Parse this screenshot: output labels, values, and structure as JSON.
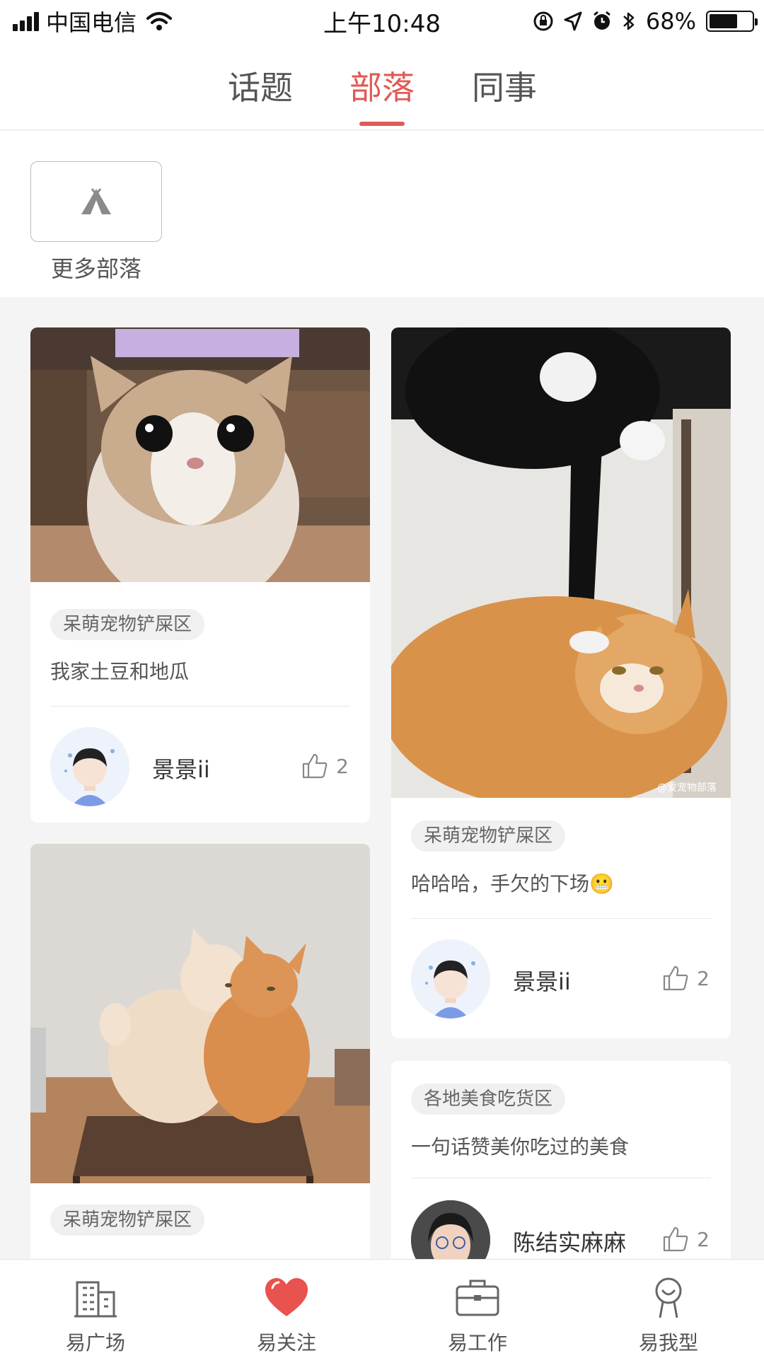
{
  "status_bar": {
    "carrier": "中国电信",
    "time": "上午10:48",
    "battery": "68%",
    "battery_level": 0.68
  },
  "top_tabs": [
    {
      "label": "话题",
      "active": false
    },
    {
      "label": "部落",
      "active": true
    },
    {
      "label": "同事",
      "active": false
    }
  ],
  "tribes": {
    "more_label": "更多部落"
  },
  "feed": {
    "posts": [
      {
        "tag": "呆萌宠物铲屎区",
        "text": "我家土豆和地瓜",
        "author": "景景ii",
        "likes": "2"
      },
      {
        "tag": "呆萌宠物铲屎区",
        "text": "哈哈哈，手欠的下场😬",
        "author": "景景ii",
        "likes": "2"
      },
      {
        "tag": "呆萌宠物铲屎区",
        "text": "",
        "author": "",
        "likes": ""
      },
      {
        "tag": "各地美食吃货区",
        "text": "一句话赞美你吃过的美食",
        "author": "陈结实麻麻",
        "likes": "2"
      }
    ],
    "watermark": "@爱宠物部落"
  },
  "bottom_nav": [
    {
      "label": "易广场",
      "icon": "building-icon"
    },
    {
      "label": "易关注",
      "icon": "heart-icon"
    },
    {
      "label": "易工作",
      "icon": "briefcase-icon"
    },
    {
      "label": "易我型",
      "icon": "person-icon"
    }
  ],
  "colors": {
    "accent": "#e05a55",
    "background": "#f4f4f4"
  }
}
